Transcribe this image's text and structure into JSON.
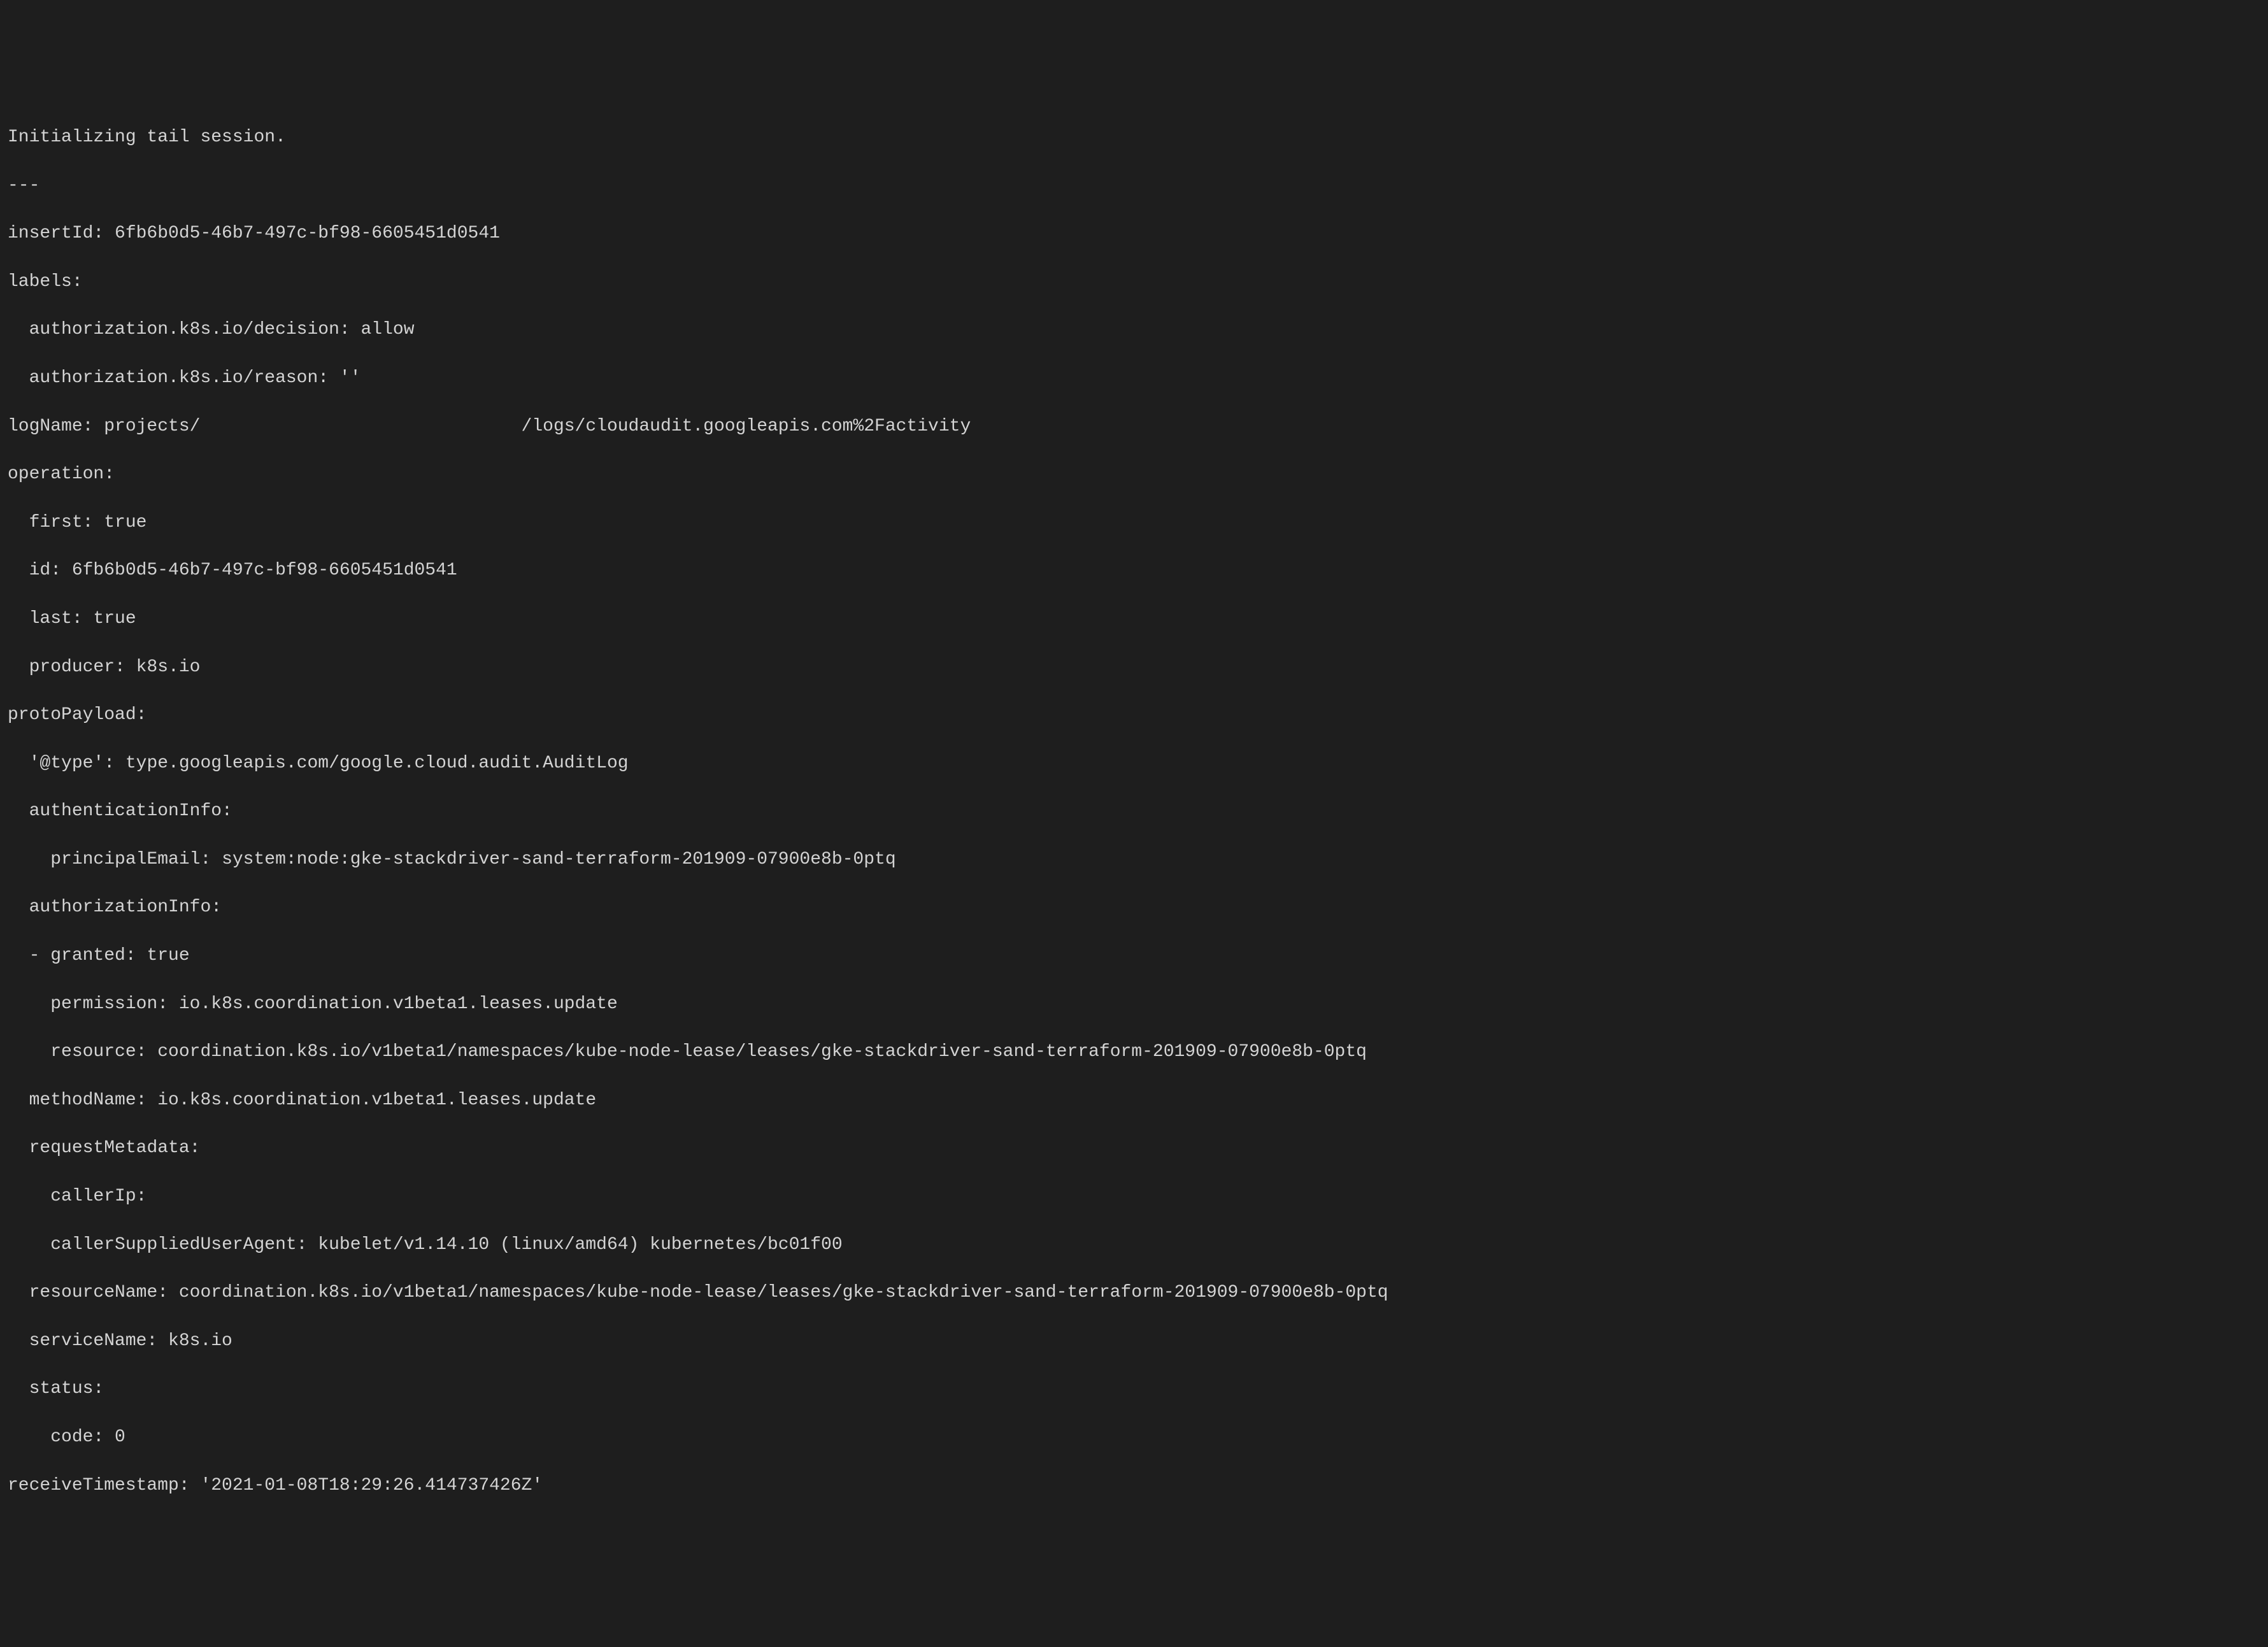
{
  "terminal": {
    "lines": [
      "Initializing tail session.",
      "---",
      "insertId: 6fb6b0d5-46b7-497c-bf98-6605451d0541",
      "labels:",
      "  authorization.k8s.io/decision: allow",
      "  authorization.k8s.io/reason: ''",
      "logName: projects/                              /logs/cloudaudit.googleapis.com%2Factivity",
      "operation:",
      "  first: true",
      "  id: 6fb6b0d5-46b7-497c-bf98-6605451d0541",
      "  last: true",
      "  producer: k8s.io",
      "protoPayload:",
      "  '@type': type.googleapis.com/google.cloud.audit.AuditLog",
      "  authenticationInfo:",
      "    principalEmail: system:node:gke-stackdriver-sand-terraform-201909-07900e8b-0ptq",
      "  authorizationInfo:",
      "  - granted: true",
      "    permission: io.k8s.coordination.v1beta1.leases.update",
      "    resource: coordination.k8s.io/v1beta1/namespaces/kube-node-lease/leases/gke-stackdriver-sand-terraform-201909-07900e8b-0ptq",
      "  methodName: io.k8s.coordination.v1beta1.leases.update",
      "  requestMetadata:",
      "    callerIp:",
      "    callerSuppliedUserAgent: kubelet/v1.14.10 (linux/amd64) kubernetes/bc01f00",
      "  resourceName: coordination.k8s.io/v1beta1/namespaces/kube-node-lease/leases/gke-stackdriver-sand-terraform-201909-07900e8b-0ptq",
      "  serviceName: k8s.io",
      "  status:",
      "    code: 0",
      "receiveTimestamp: '2021-01-08T18:29:26.414737426Z'"
    ]
  }
}
